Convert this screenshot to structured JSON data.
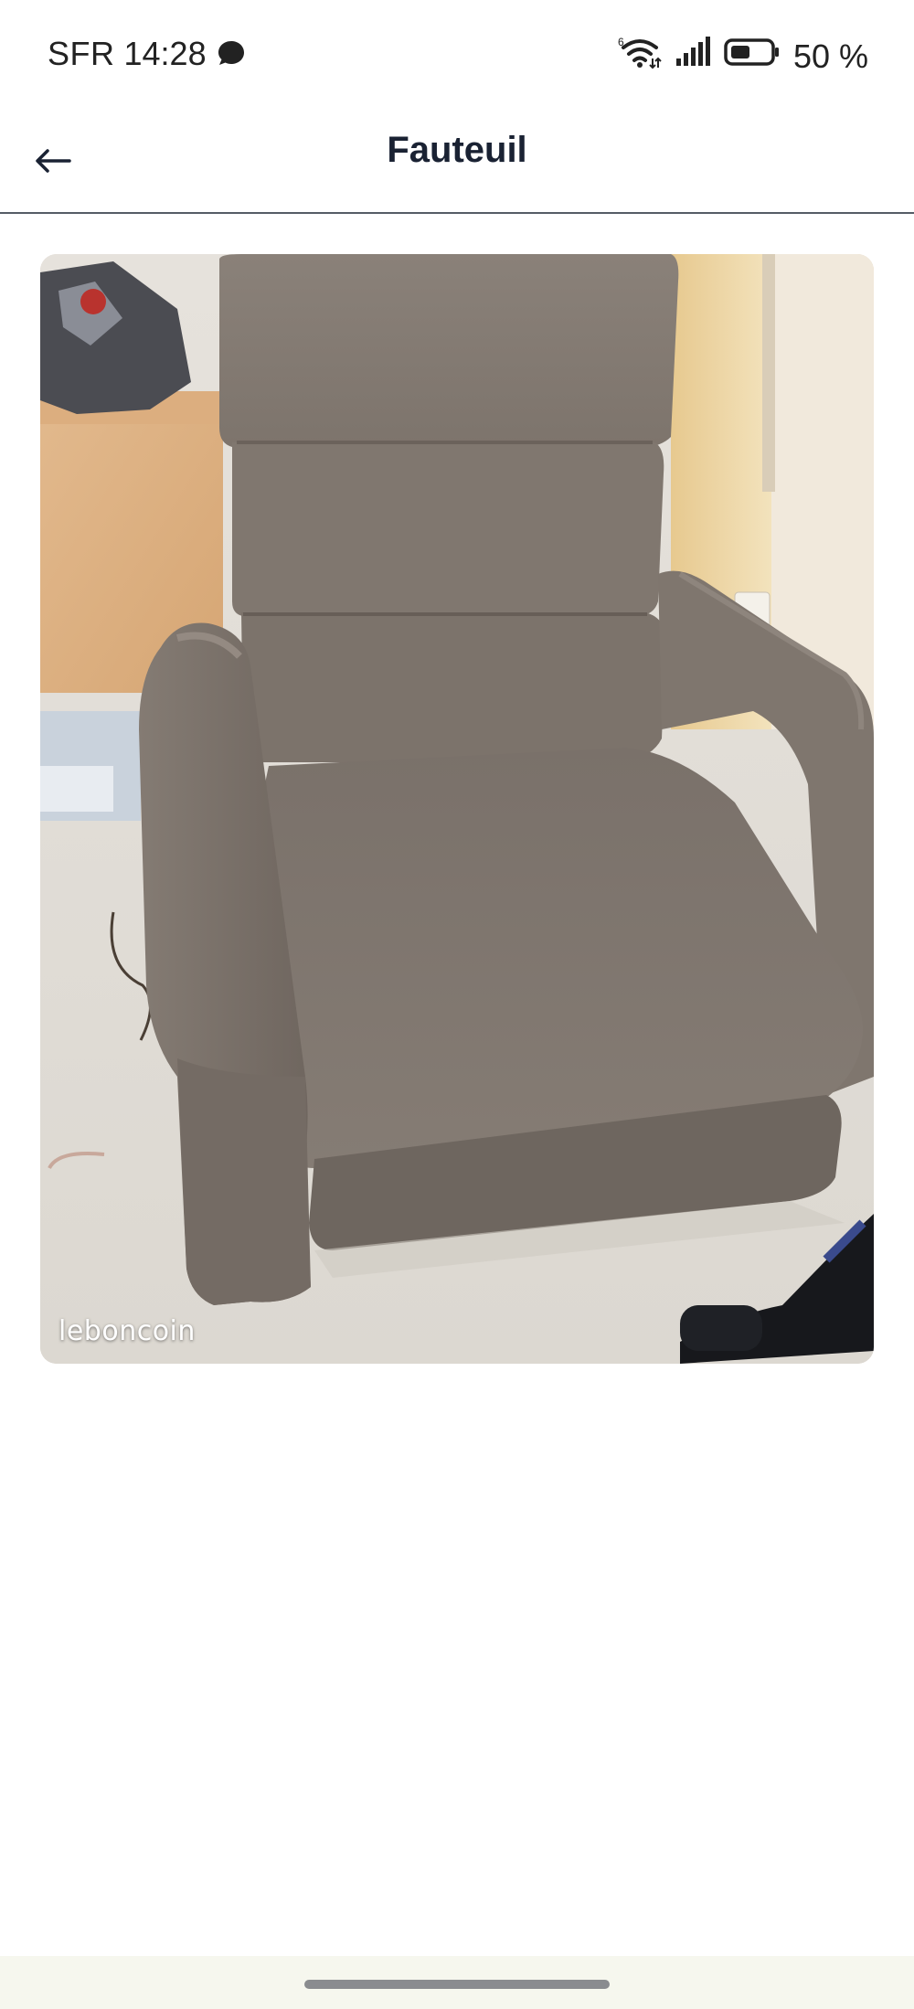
{
  "status_bar": {
    "carrier": "SFR",
    "time": "14:28",
    "battery_percent": "50 %",
    "wifi_label": "6",
    "icons": [
      "chat-bubble-icon",
      "wifi-icon",
      "signal-icon",
      "battery-icon"
    ]
  },
  "app_bar": {
    "back_icon": "arrow-left-icon",
    "title": "Fauteuil"
  },
  "photo": {
    "watermark": "leboncoin",
    "subject": "grey fabric recliner armchair"
  },
  "colors": {
    "title": "#1a2233",
    "divider": "#555c66",
    "nav_strip": "#f6f7ee",
    "gesture_bar": "#8a8c8f"
  }
}
